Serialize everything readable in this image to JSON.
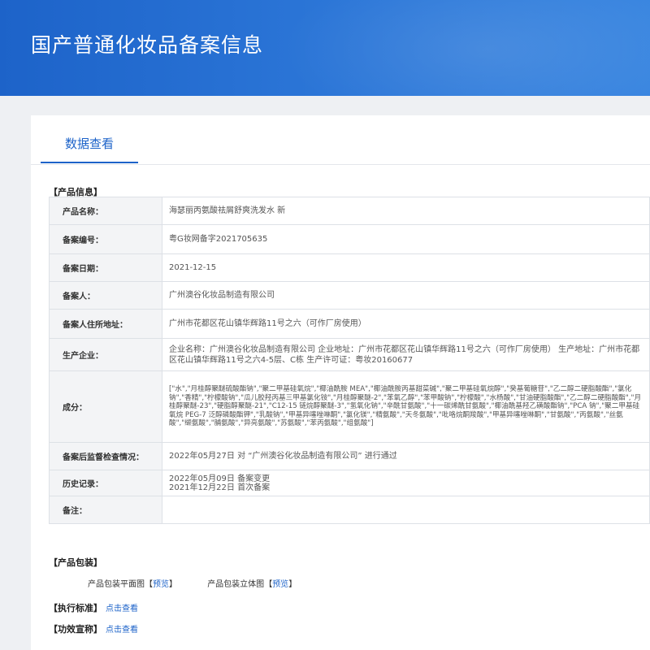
{
  "header": {
    "title": "国产普通化妆品备案信息"
  },
  "tabs": [
    {
      "label": "数据查看"
    }
  ],
  "product_info": {
    "section_title": "【产品信息】",
    "rows": [
      {
        "label": "产品名称：",
        "value": "海瑟丽丙氨酸祛屑舒爽洗发水 新"
      },
      {
        "label": "备案编号：",
        "value": "粤G妆网备字2021705635"
      },
      {
        "label": "备案日期：",
        "value": "2021-12-15"
      },
      {
        "label": "备案人：",
        "value": "广州澳谷化妆品制造有限公司"
      },
      {
        "label": "备案人住所地址：",
        "value": "广州市花都区花山镇华辉路11号之六（可作厂房使用）"
      },
      {
        "label": "生产企业：",
        "value": "企业名称：广州澳谷化妆品制造有限公司 企业地址：广州市花都区花山镇华辉路11号之六（可作厂房使用） 生产地址：广州市花都区花山镇华辉路11号之六4-5层、C栋 生产许可证：粤妆20160677"
      },
      {
        "label": "成分：",
        "value": "[\"水\",\"月桂醇聚醚硫酸酯钠\",\"聚二甲基硅氧烷\",\"椰油酰胺 MEA\",\"椰油酰胺丙基甜菜碱\",\"聚二甲基硅氧烷醇\",\"癸基葡糖苷\",\"乙二醇二硬脂酸酯\",\"氯化钠\",\"香精\",\"柠檬酸钠\",\"瓜儿胶羟丙基三甲基氯化铵\",\"月桂醇聚醚-2\",\"苯氧乙醇\",\"苯甲酸钠\",\"柠檬酸\",\"水杨酸\",\"甘油硬脂酸酯\",\"乙二醇二硬脂酸酯\",\"月桂醇聚醚-23\",\"硬脂醇聚醚-21\",\"C12-15 链烷醇聚醚-3\",\"氢氧化钠\",\"辛酰甘氨酸\",\"十一碳烯酰甘氨酸\",\"椰油酰基羟乙磺酸酯钠\",\"PCA 钠\",\"聚二甲基硅氧烷 PEG-7 泛醇磷酸酯钾\",\"乳酸钠\",\"甲基异噻唑啉酮\",\"氯化镁\",\"精氨酸\",\"天冬氨酸\",\"吡咯烷酮羧酸\",\"甲基异噻唑啉酮\",\"甘氨酸\",\"丙氨酸\",\"丝氨酸\",\"缬氨酸\",\"脯氨酸\",\"异亮氨酸\",\"苏氨酸\",\"苯丙氨酸\",\"组氨酸\"]"
      },
      {
        "label": "备案后监督检查情况：",
        "value": "2022年05月27日 对 “广州澳谷化妆品制造有限公司” 进行通过"
      },
      {
        "label": "历史记录：",
        "lines": [
          "2022年05月09日 备案变更",
          "2021年12月22日 首次备案"
        ]
      },
      {
        "label": "备注：",
        "value": ""
      }
    ]
  },
  "packaging": {
    "section_title": "【产品包装】",
    "items": [
      {
        "label": "产品包装平面图",
        "bracket_open": "【",
        "link": "预览",
        "bracket_close": "】"
      },
      {
        "label": "产品包装立体图",
        "bracket_open": "【",
        "link": "预览",
        "bracket_close": "】"
      }
    ]
  },
  "standard": {
    "label": "【执行标准】",
    "link": "点击查看"
  },
  "claims": {
    "label": "【功效宣称】",
    "link": "点击查看"
  },
  "colors": {
    "primary": "#1d63c9",
    "label_bg": "#f3f4f6",
    "page_bg": "#eef0f3"
  }
}
